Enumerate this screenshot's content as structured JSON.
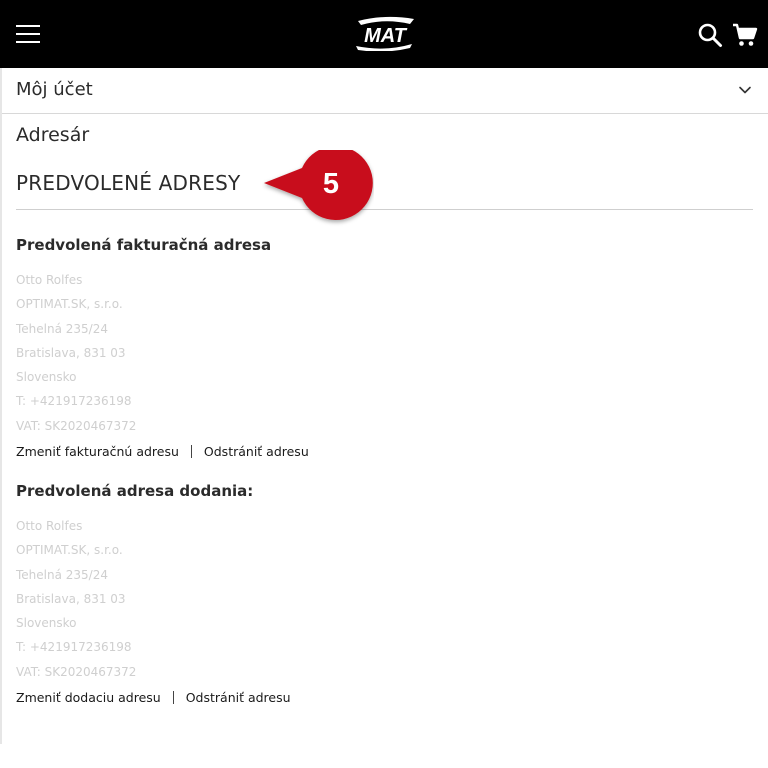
{
  "header": {
    "logo_text": "MAT",
    "icons": [
      "menu-icon",
      "search-icon",
      "cart-icon"
    ],
    "background": "#000000"
  },
  "account": {
    "label": "Môj účet"
  },
  "page": {
    "title": "Adresár",
    "section_title": "PREDVOLENÉ ADRESY"
  },
  "callout": {
    "number": "5",
    "color": "#c8101a"
  },
  "billing": {
    "heading": "Predvolená fakturačná adresa",
    "lines": [
      "Otto Rolfes",
      "OPTIMAT.SK, s.r.o.",
      "Tehelná 235/24",
      "Bratislava, 831 03",
      "Slovensko",
      "T: +421917236198",
      "VAT: SK2020467372"
    ],
    "change_label": "Zmeniť fakturačnú adresu",
    "remove_label": "Odstrániť adresu"
  },
  "shipping": {
    "heading": "Predvolená adresa dodania:",
    "lines": [
      "Otto Rolfes",
      "OPTIMAT.SK, s.r.o.",
      "Tehelná 235/24",
      "Bratislava, 831 03",
      "Slovensko",
      "T: +421917236198",
      "VAT: SK2020467372"
    ],
    "change_label": "Zmeniť dodaciu adresu",
    "remove_label": "Odstrániť adresu"
  }
}
